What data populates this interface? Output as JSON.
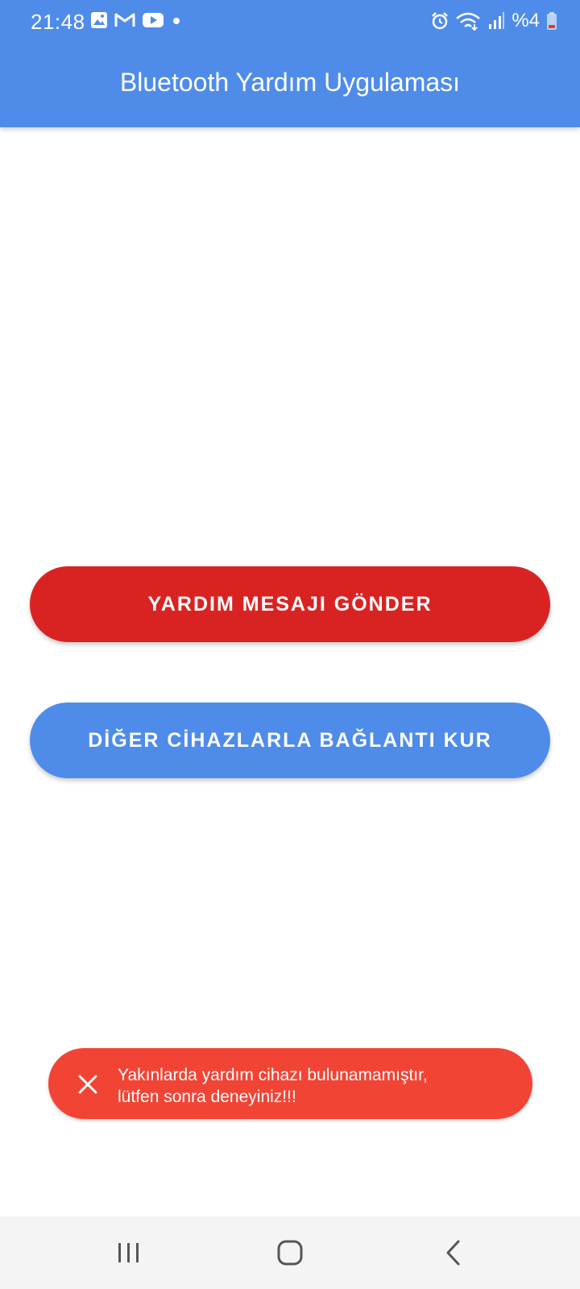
{
  "status_bar": {
    "time": "21:48",
    "left_icons": [
      "gallery-icon",
      "gmail-icon",
      "youtube-icon",
      "dot-icon"
    ],
    "right_icons": [
      "alarm-icon",
      "wifi-icon",
      "signal-icon",
      "battery-icon"
    ],
    "battery_text": "%4"
  },
  "app_bar": {
    "title": "Bluetooth Yardım Uygulaması",
    "color": "#4f8ce9"
  },
  "actions": {
    "help_button_label": "YARDIM MESAJI GÖNDER",
    "help_button_color": "#d92323",
    "connect_button_label": "DİĞER CİHAZLARLA BAĞLANTI KUR",
    "connect_button_color": "#4f8ce9"
  },
  "toast": {
    "line1": "Yakınlarda yardım cihazı bulunamamıştır,",
    "line2": "lütfen sonra deneyiniz!!!",
    "color": "#f24435",
    "icon": "close-icon"
  },
  "nav_bar": {
    "icons": [
      "recents-icon",
      "home-icon",
      "back-icon"
    ]
  }
}
